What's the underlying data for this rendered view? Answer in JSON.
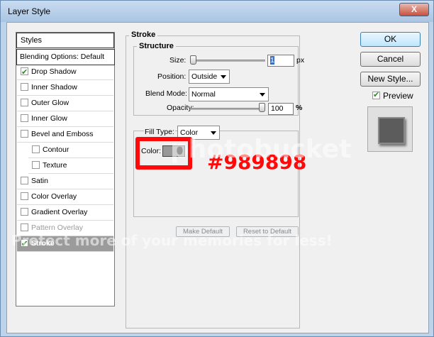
{
  "window": {
    "title": "Layer Style",
    "close_symbol": "X"
  },
  "styles_panel": {
    "header": "Styles",
    "items": [
      {
        "label": "Blending Options: Default",
        "checkbox": false,
        "checked": false
      },
      {
        "label": "Drop Shadow",
        "checkbox": true,
        "checked": true
      },
      {
        "label": "Inner Shadow",
        "checkbox": true,
        "checked": false
      },
      {
        "label": "Outer Glow",
        "checkbox": true,
        "checked": false
      },
      {
        "label": "Inner Glow",
        "checkbox": true,
        "checked": false
      },
      {
        "label": "Bevel and Emboss",
        "checkbox": true,
        "checked": false
      },
      {
        "label": "Contour",
        "checkbox": true,
        "checked": false
      },
      {
        "label": "Texture",
        "checkbox": true,
        "checked": false
      },
      {
        "label": "Satin",
        "checkbox": true,
        "checked": false
      },
      {
        "label": "Color Overlay",
        "checkbox": true,
        "checked": false
      },
      {
        "label": "Gradient Overlay",
        "checkbox": true,
        "checked": false
      },
      {
        "label": "Pattern Overlay",
        "checkbox": true,
        "checked": false
      },
      {
        "label": "Stroke",
        "checkbox": true,
        "checked": true,
        "selected": true
      }
    ]
  },
  "stroke": {
    "group_title": "Stroke",
    "structure_title": "Structure",
    "size_label": "Size:",
    "size_value": "1",
    "size_unit": "px",
    "position_label": "Position:",
    "position_value": "Outside",
    "blend_mode_label": "Blend Mode:",
    "blend_mode_value": "Normal",
    "opacity_label": "Opacity:",
    "opacity_value": "100",
    "opacity_unit": "%",
    "opacity_level": 1.0,
    "size_level": 0.0,
    "fill_type_label": "Fill Type:",
    "fill_type_value": "Color",
    "color_label": "Color:",
    "color_hex": "#989898"
  },
  "annotation": {
    "hex_text": "#989898",
    "color": "#ff0a0a"
  },
  "buttons": {
    "ok": "OK",
    "cancel": "Cancel",
    "new_style": "New Style...",
    "make_default": "Make Default",
    "reset_to_default": "Reset to Default"
  },
  "preview": {
    "label": "Preview",
    "checked": true
  },
  "watermark": {
    "line1": "photobucket",
    "line2": "Protect more of your memories for less!"
  }
}
